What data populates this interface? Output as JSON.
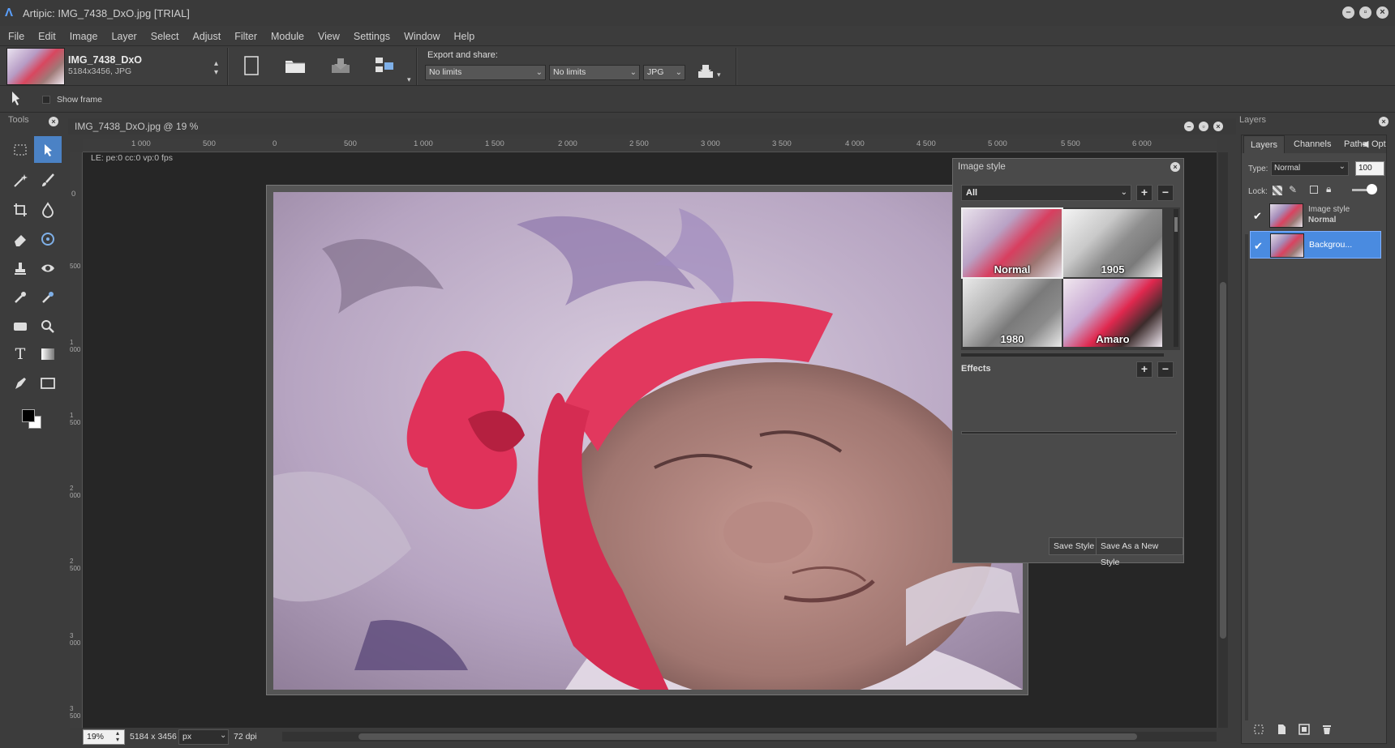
{
  "window": {
    "title": "Artipic: IMG_7438_DxO.jpg [TRIAL]",
    "buttons": [
      "minimize",
      "maximize",
      "close"
    ]
  },
  "menu": [
    "File",
    "Edit",
    "Image",
    "Layer",
    "Select",
    "Adjust",
    "Filter",
    "Module",
    "View",
    "Settings",
    "Window",
    "Help"
  ],
  "toolbar": {
    "doc_name": "IMG_7438_DxO",
    "doc_info": "5184x3456, JPG",
    "export_label": "Export and share:",
    "size1": "No limits",
    "size2": "No limits",
    "format": "JPG"
  },
  "options": {
    "show_frame_label": "Show frame"
  },
  "tools": {
    "header": "Tools"
  },
  "document": {
    "title": "IMG_7438_DxO.jpg @ 19 %",
    "fps": "LE: pe:0 cc:0 vp:0 fps",
    "ruler_top": [
      "1 000",
      "500",
      "0",
      "500",
      "1 000",
      "1 500",
      "2 000",
      "2 500",
      "3 000",
      "3 500",
      "4 000",
      "4 500",
      "5 000",
      "5 500",
      "6 000"
    ],
    "ruler_left": [
      "0",
      "500",
      "1 000",
      "1 500",
      "2 000",
      "2 500",
      "3 000",
      "3 500"
    ]
  },
  "status": {
    "zoom": "19%",
    "dimensions": "5184 x 3456",
    "unit": "px",
    "dpi": "72",
    "dpi_label": "dpi"
  },
  "image_style_panel": {
    "title": "Image style",
    "filter": "All",
    "thumbs": [
      {
        "label": "Normal"
      },
      {
        "label": "1905"
      },
      {
        "label": "1980"
      },
      {
        "label": "Amaro"
      }
    ],
    "effects_label": "Effects",
    "save_style": "Save Style",
    "save_new_style": "Save As a New Style"
  },
  "layers_panel": {
    "header": "Layers",
    "tabs": [
      "Layers",
      "Channels",
      "Paths",
      "Opt"
    ],
    "type_label": "Type:",
    "blend_mode": "Normal",
    "opacity": "100",
    "lock_label": "Lock:",
    "layers": [
      {
        "name": "Image style",
        "mode": "Normal",
        "visible": true,
        "selected": false
      },
      {
        "name": "Backgrou...",
        "mode": "",
        "visible": true,
        "selected": true
      }
    ]
  },
  "colors": {
    "accent": "#4b82c5",
    "selected_layer": "#4a8be0",
    "canvas_bg": "#262626"
  }
}
